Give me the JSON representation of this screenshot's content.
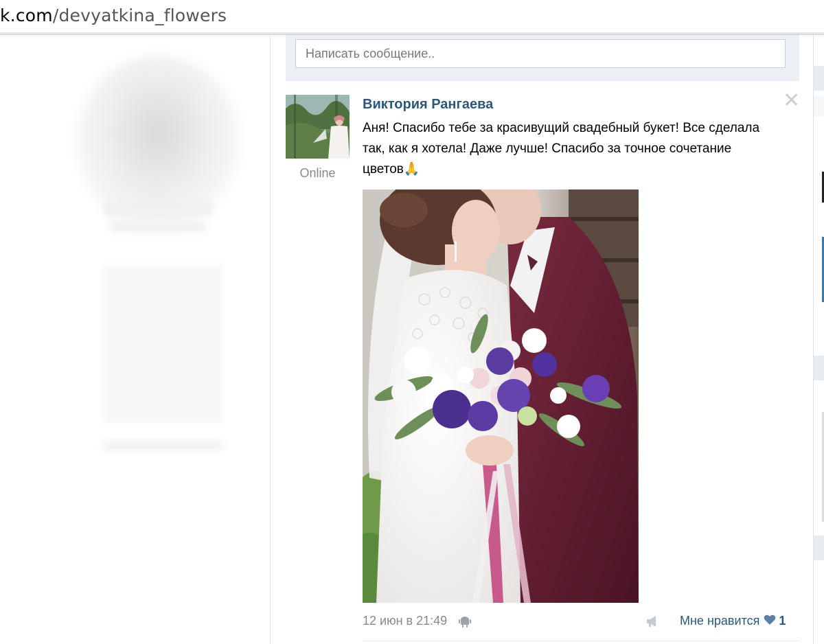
{
  "address_bar": {
    "host": "k.com",
    "path": "/devyatkina_flowers"
  },
  "compose": {
    "placeholder": "Написать сообщение.."
  },
  "post": {
    "author": "Виктория Рангаева",
    "status": "Online",
    "text": "Аня! Спасибо тебе за красивущий свадебный букет! Все сделала так, как я хотела! Даже лучше! Спасибо за точное сочетание цветов🙏",
    "date": "12 июн в 21:49",
    "platform_icon": "android-icon",
    "like_label": "Мне нравится",
    "like_count": "1",
    "close_icon": "close-icon"
  },
  "colors": {
    "link": "#2b587a",
    "muted": "#888888",
    "compose_bg": "#eceff3"
  }
}
